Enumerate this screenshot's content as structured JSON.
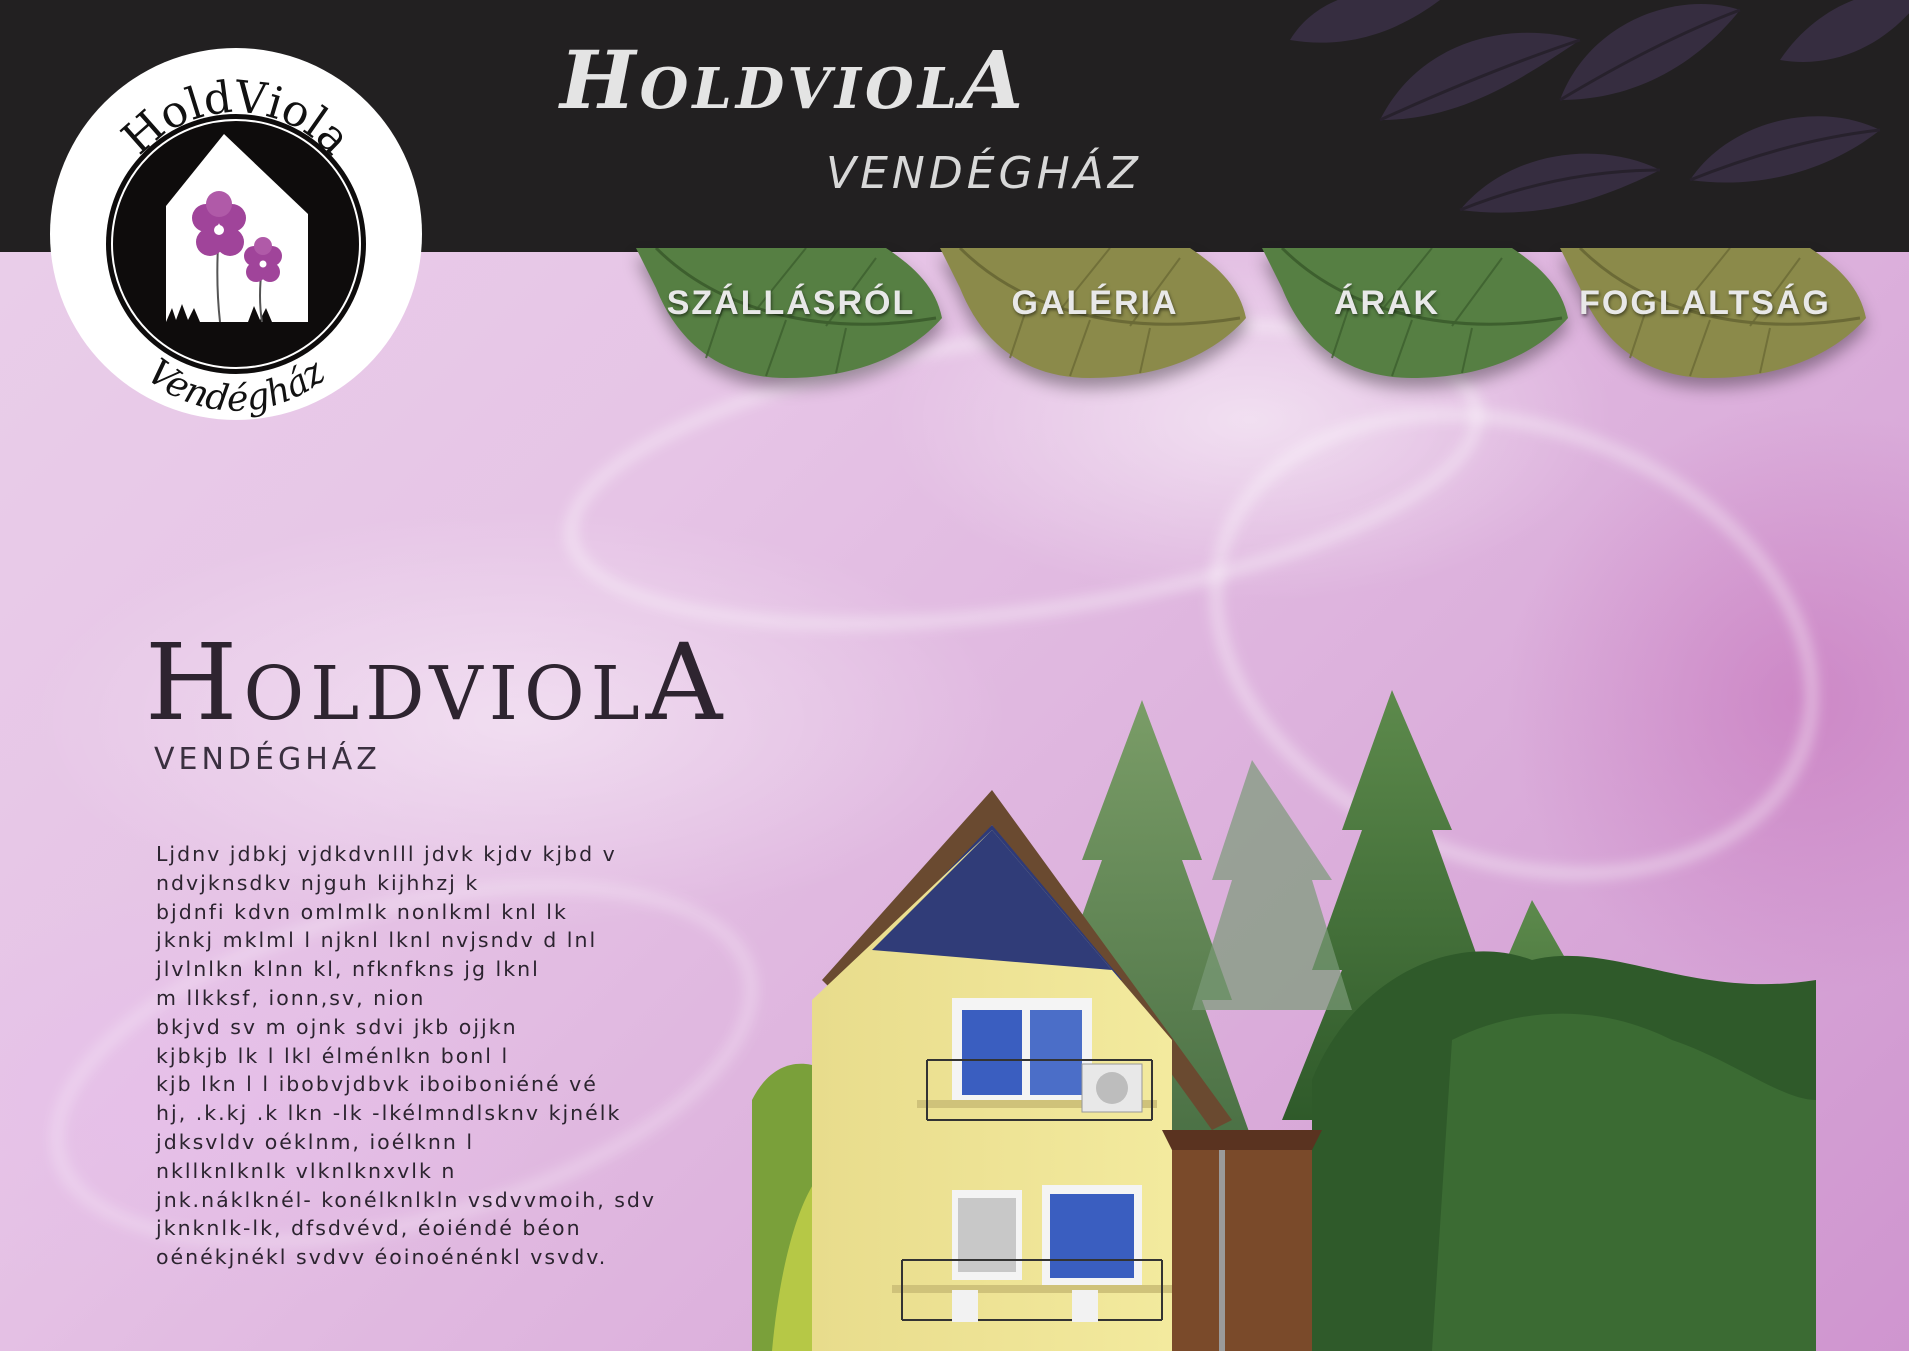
{
  "header": {
    "title": "HoldviolA",
    "subtitle": "VENDÉGHÁZ"
  },
  "logo": {
    "top_text": "HoldViola",
    "bottom_text": "Vendégház"
  },
  "nav": {
    "items": [
      {
        "label": "SZÁLLÁSRÓL"
      },
      {
        "label": "GALÉRIA"
      },
      {
        "label": "ÁRAK"
      },
      {
        "label": "FOGLALTSÁG"
      }
    ]
  },
  "main": {
    "title": "HoldviolA",
    "subtitle": "VENDÉGHÁZ",
    "description_lines": [
      "Ljdnv  jdbkj vjdkdvnlll jdvk kjdv  kjbd v",
      "ndvjknsdkv njguh kijhhzj k",
      "bjdnfi kdvn omlmlk nonlkml knl  lk",
      "jknkj  mklml l njknl lknl nvjsndv d lnl",
      "jlvlnlkn  klnn kl, nfknfkns jg lknl",
      "m llkksf, ionn,sv, nion",
      "bkjvd sv m ojnk sdvi jkb ojjkn",
      "kjbkjb lk l lkl élménlkn  bonl l",
      "kjb lkn l l ibobvjdbvk iboiboniéné vé",
      "hj, .k.kj .k lkn -lk -lkélmndlsknv kjnélk",
      "jdksvldv   oéklnm, ioélknn l",
      "nkllknlknlk vlknlknxvlk n",
      "jnk.náklknél- konélknlkln vsdvvmoih, sdv",
      "jknknlk-lk, dfsdvévd, éoiéndé béon",
      "oénékjnékl svdvv éoinoénénkl vsvdv."
    ]
  },
  "colors": {
    "header_bg": "#222021",
    "nav_leaf_green": "#4e7a3e",
    "nav_leaf_olive": "#8a8a48",
    "text_dark": "#2e2430",
    "page_pink": "#e6c4e6"
  }
}
